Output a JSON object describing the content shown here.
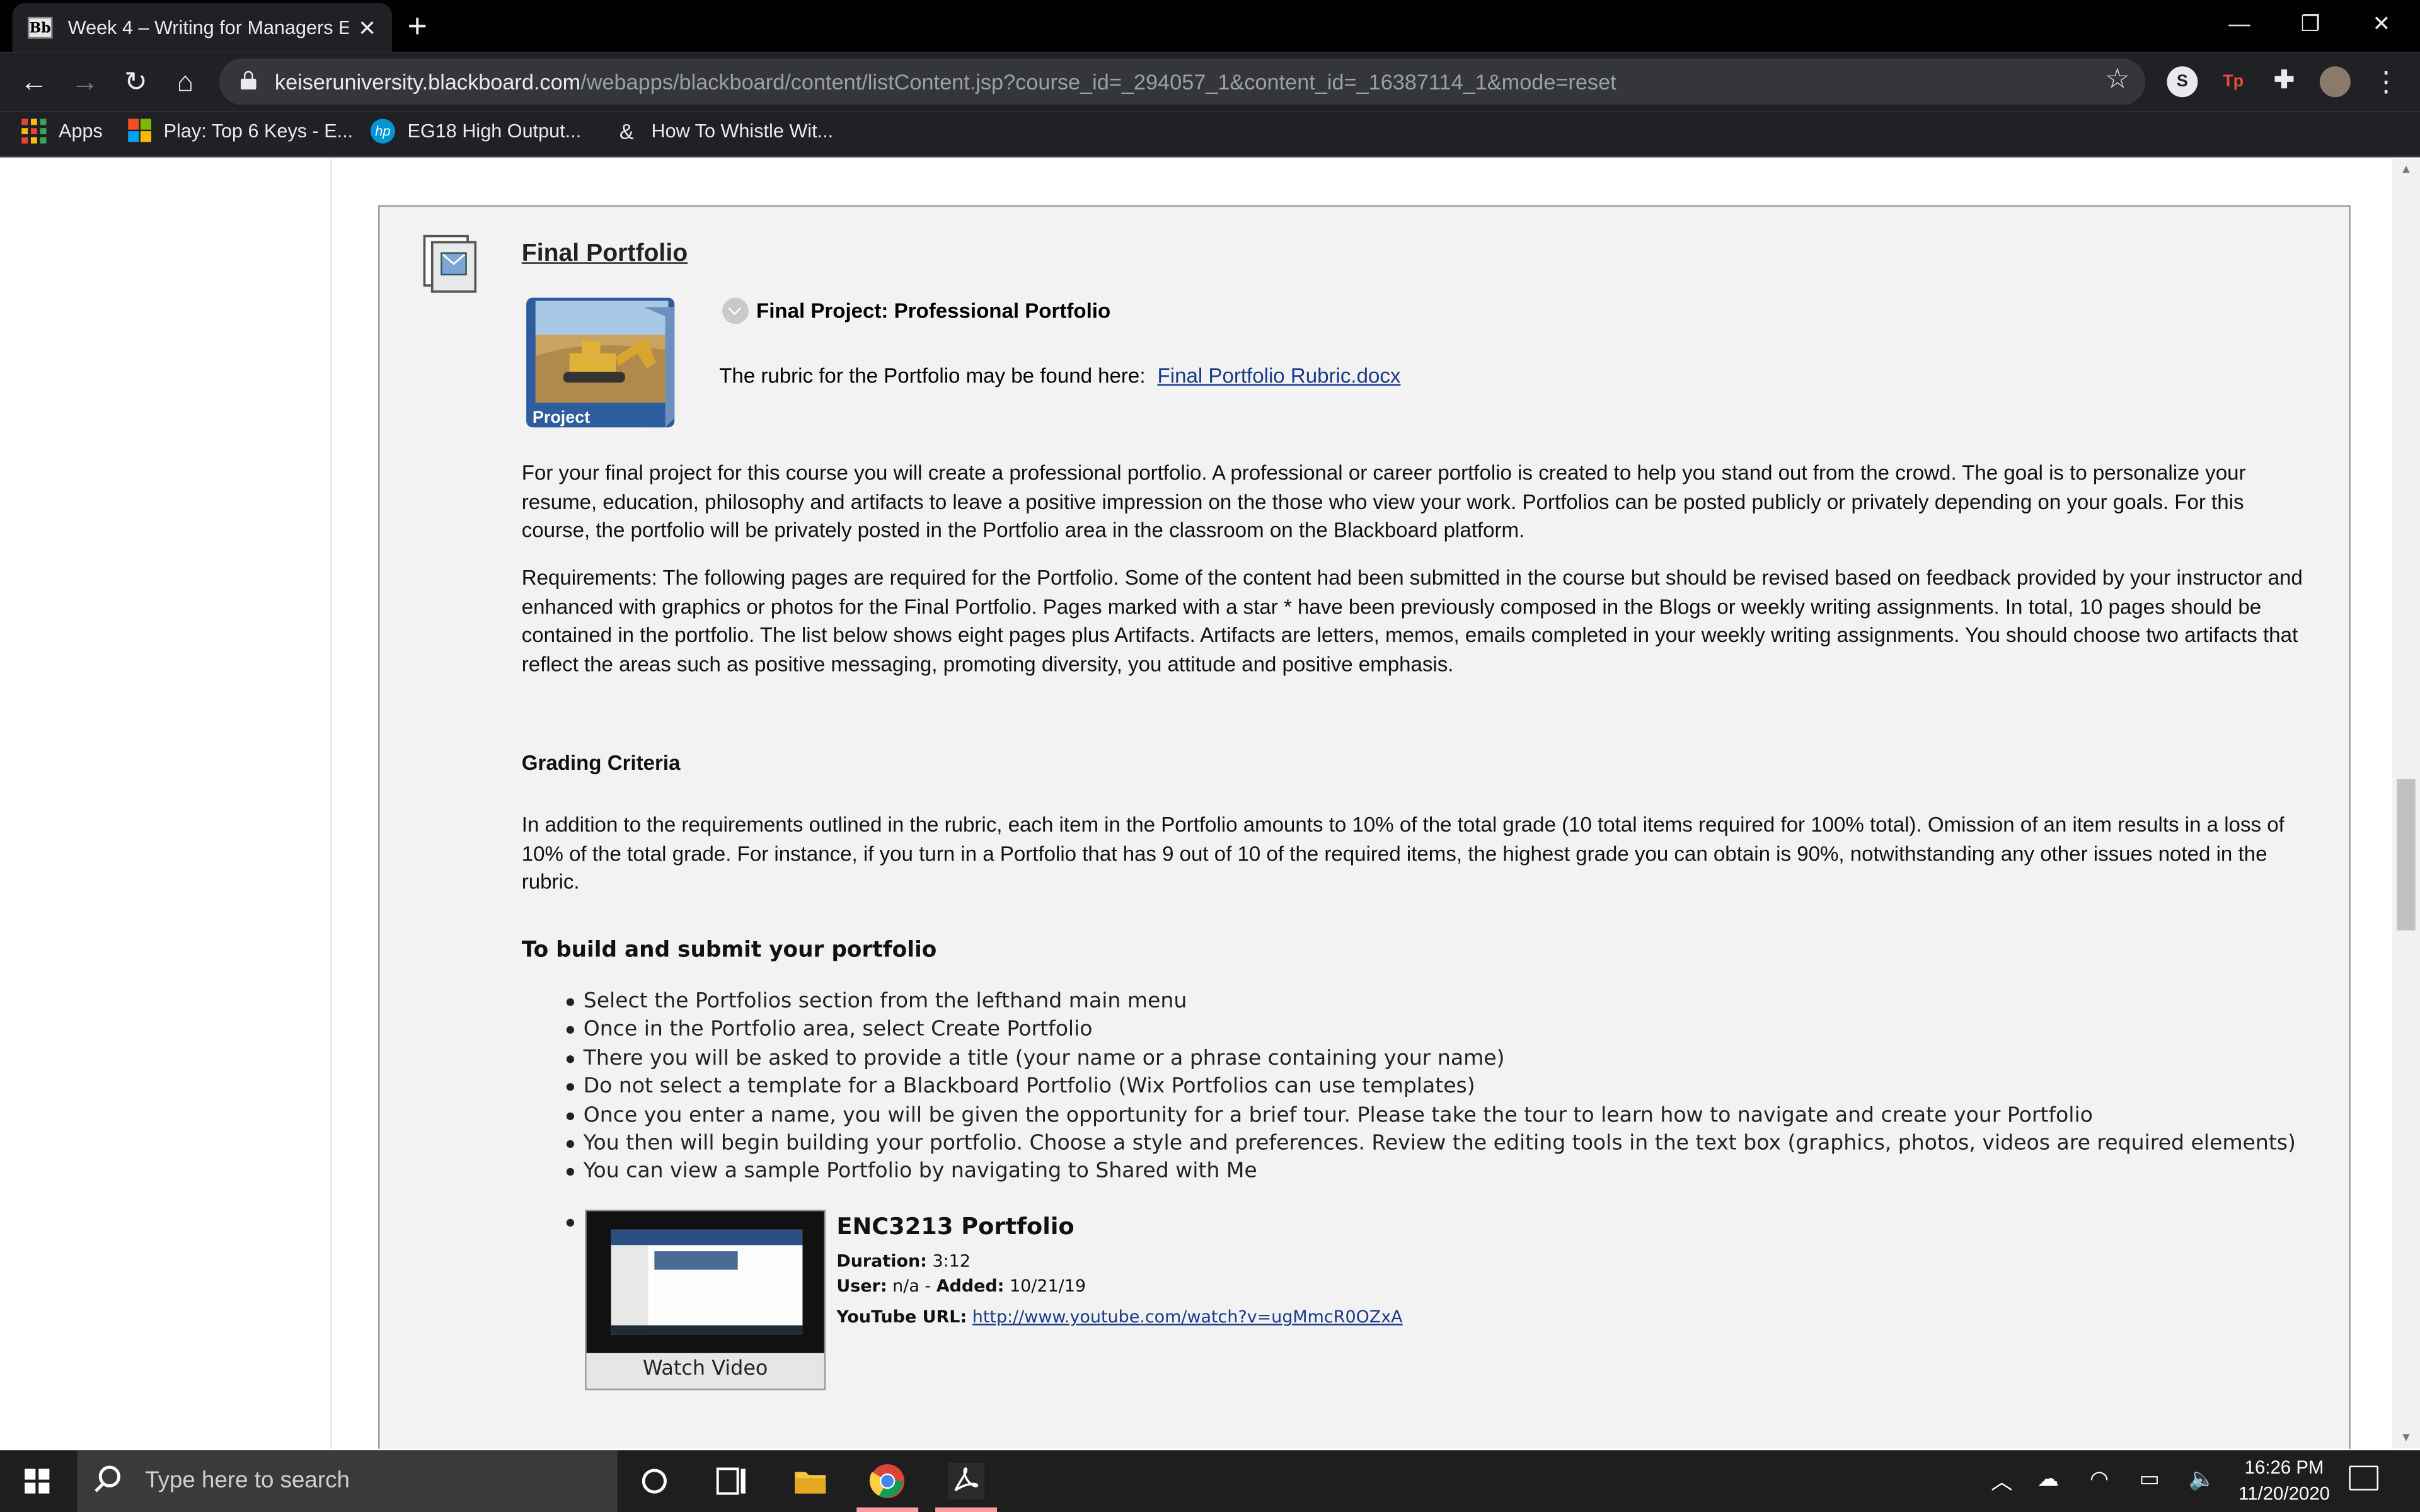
{
  "browser": {
    "tab_title": "Week 4 – Writing for Managers E",
    "tab_favicon": "Bb",
    "url_host": "keiseruniversity.blackboard.com",
    "url_path": "/webapps/blackboard/content/listContent.jsp?course_id=_294057_1&content_id=_16387114_1&mode=reset",
    "bookmarks": [
      {
        "label": "Apps",
        "icon": "apps-grid-icon"
      },
      {
        "label": "Play: Top 6 Keys - E...",
        "icon": "microsoft-logo-icon"
      },
      {
        "label": "EG18 High Output...",
        "icon": "hp-logo-icon"
      },
      {
        "label": "How To Whistle Wit...",
        "icon": "whistle-site-icon"
      }
    ],
    "extensions": [
      {
        "label": "S",
        "icon": "s-extension-icon"
      },
      {
        "label": "Tp",
        "icon": "tp-extension-icon"
      },
      {
        "label": "",
        "icon": "puzzle-extensions-icon"
      },
      {
        "label": "",
        "icon": "profile-avatar-icon"
      }
    ]
  },
  "item": {
    "title": "Final Portfolio",
    "image_label": "Project",
    "project_heading": "Final Project: Professional Portfolio",
    "rubric_text": "The rubric for the Portfolio may be found here:",
    "rubric_link": "Final Portfolio Rubric.docx",
    "intro_para": "For your final project for this course you will create a professional portfolio. A professional or career portfolio is created to help you stand out from the crowd.  The goal is to personalize your resume, education, philosophy and artifacts to leave a positive impression on the those who view your work.  Portfolios can be posted publicly or privately depending on your goals.  For this course, the portfolio will be privately posted in the Portfolio area in the classroom on the Blackboard platform.",
    "requirements_para": "Requirements: The following pages are required for the Portfolio. Some of the content had been submitted in the course but should be revised based on feedback provided by your instructor and enhanced with graphics or photos for the Final Portfolio. Pages marked with a star * have been previously composed in the Blogs or weekly writing assignments.  In total, 10 pages should be contained in the portfolio. The list below shows eight pages plus Artifacts.  Artifacts are letters, memos, emails completed in your weekly writing assignments.  You should choose two artifacts that reflect the areas such as positive messaging, promoting diversity, you attitude and positive emphasis.",
    "grading_heading": "Grading Criteria",
    "grading_para": "In addition to the requirements outlined in the rubric, each item in the Portfolio amounts to 10% of the total grade (10 total items required for 100% total). Omission of an item results in a loss of 10% of the total grade. For instance, if you turn in a Portfolio that has 9 out of 10 of the required items, the highest grade you can obtain is 90%, notwithstanding any other issues noted in the rubric.",
    "build_heading": "To build and submit your portfolio",
    "steps": [
      "Select the Portfolios section from the lefthand main menu",
      "Once in the Portfolio area, select Create Portfolio",
      "There you will be asked to provide a title (your name or a phrase containing your name)",
      "Do not select a template for a Blackboard Portfolio (Wix Portfolios can use templates)",
      "Once you enter a name, you will be given the opportunity for a brief tour.  Please take the tour to learn how to navigate and create your Portfolio",
      "You then will begin building your portfolio. Choose a style and preferences.  Review the editing tools in the text box (graphics, photos, videos are required elements)",
      "You can view a sample Portfolio by navigating to Shared with Me"
    ],
    "video": {
      "title": "ENC3213 Portfolio",
      "duration_label": "Duration:",
      "duration": "3:12",
      "user_label": "User:",
      "user": "n/a",
      "added_label": "Added:",
      "added": "10/21/19",
      "url_label": "YouTube URL:",
      "url": "http://www.youtube.com/watch?v=ugMmcR0OZxA",
      "watch_label": "Watch Video"
    }
  },
  "taskbar": {
    "search_placeholder": "Type here to search",
    "time": "16:26 PM",
    "date": "11/20/2020"
  }
}
